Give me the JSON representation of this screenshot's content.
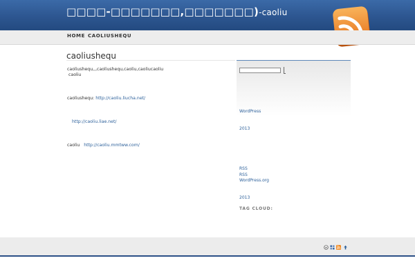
{
  "header": {
    "title": "□□□□-□□□□□□□,□□□□□□□)",
    "title_suffix": "-caoliu",
    "rss_icon": "rss-feed-icon"
  },
  "nav": {
    "items": [
      {
        "label": "Home"
      },
      {
        "label": "caoliushequ"
      }
    ]
  },
  "post": {
    "title": "caoliushequ",
    "line1": "caoliushequ,,,caoliushequ,caoliu,caoliucaoliu",
    "line2": "caoliu",
    "link1_prefix": "caoliushequ:",
    "link1": "http://caoliu.liucha.net/",
    "link2": "http://caoliu.liae.net/",
    "link3_prefix": "caoliu",
    "link3": "http://caoliu.mmtww.com/"
  },
  "sidebar": {
    "search_placeholder": "",
    "link_wordpress": "WordPress",
    "archive1": "2013",
    "meta_rss1": "RSS",
    "meta_rss2": "RSS",
    "meta_wporg": "WordPress.org",
    "archive2": "2013",
    "tag_cloud": "Tag Cloud:"
  },
  "footer": {
    "icons": [
      "wordpress-icon",
      "grid-icon",
      "rss-small-icon",
      "arrow-up-icon"
    ]
  },
  "colors": {
    "header_blue": "#2d5690",
    "link_blue": "#2b5f9a",
    "rss_orange": "#f08a24"
  }
}
